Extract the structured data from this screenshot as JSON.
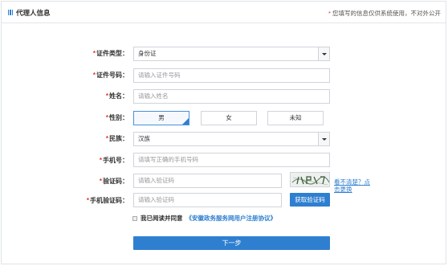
{
  "header": {
    "title": "代理人信息",
    "note_star": "*",
    "note": "您填写的信息仅供系统使用，不对外公开"
  },
  "form": {
    "id_type": {
      "label": "证件类型：",
      "value": "身份证"
    },
    "id_number": {
      "label": "证件号码：",
      "placeholder": "请输入证件号码"
    },
    "name": {
      "label": "姓名：",
      "placeholder": "请输入姓名"
    },
    "gender": {
      "label": "性别：",
      "options": [
        "男",
        "女",
        "未知"
      ],
      "selected": "男"
    },
    "ethnicity": {
      "label": "民族：",
      "value": "汉族"
    },
    "phone": {
      "label": "手机号：",
      "placeholder": "请填写正确的手机号码"
    },
    "captcha": {
      "label": "验证码：",
      "placeholder": "请输入验证码",
      "refresh_text_1": "看不清楚？点",
      "refresh_text_2": "击更换"
    },
    "sms_code": {
      "label": "手机验证码：",
      "placeholder": "请输入验证码",
      "button": "获取验证码"
    },
    "agreement": {
      "prefix": "我已阅读并同意",
      "link": "《安徽政务服务网用户注册协议》"
    },
    "next_button": "下一步"
  },
  "colors": {
    "accent": "#2f7fd0",
    "required": "#e0332b"
  }
}
